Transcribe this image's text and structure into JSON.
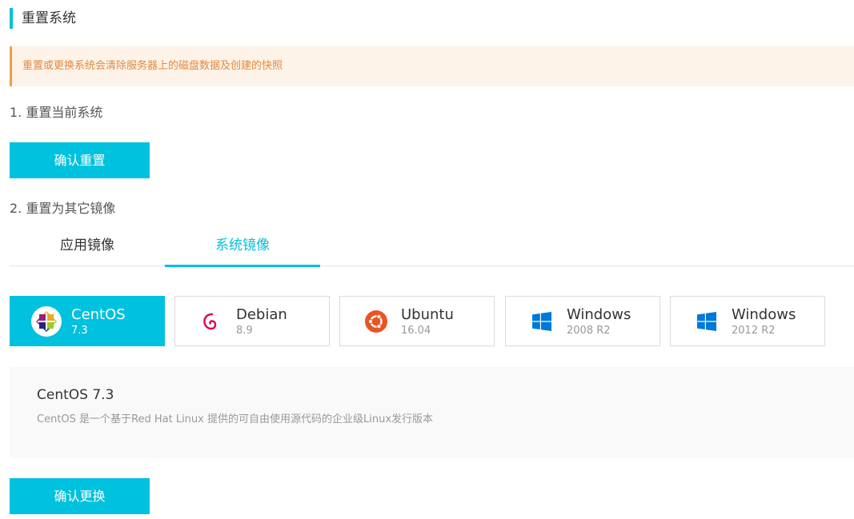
{
  "header": {
    "title": "重置系统"
  },
  "warning": {
    "text": "重置或更换系统会清除服务器上的磁盘数据及创建的快照"
  },
  "section1": {
    "title": "1. 重置当前系统",
    "button_label": "确认重置"
  },
  "section2": {
    "title": "2. 重置为其它镜像",
    "tabs": [
      {
        "label": "应用镜像",
        "active": false
      },
      {
        "label": "系统镜像",
        "active": true
      }
    ],
    "os_options": [
      {
        "name": "CentOS",
        "version": "7.3",
        "icon": "centos-icon",
        "selected": true
      },
      {
        "name": "Debian",
        "version": "8.9",
        "icon": "debian-icon",
        "selected": false
      },
      {
        "name": "Ubuntu",
        "version": "16.04",
        "icon": "ubuntu-icon",
        "selected": false
      },
      {
        "name": "Windows",
        "version": "2008 R2",
        "icon": "windows-icon",
        "selected": false
      },
      {
        "name": "Windows",
        "version": "2012 R2",
        "icon": "windows-icon",
        "selected": false
      }
    ],
    "description": {
      "title": "CentOS 7.3",
      "text": "CentOS 是一个基于Red Hat Linux 提供的可自由使用源代码的企业级Linux发行版本"
    },
    "button_label": "确认更换"
  },
  "colors": {
    "accent": "#00c1de",
    "warning_bg": "#fdf3e8",
    "warning_text": "#e6883e",
    "debian": "#d70751",
    "ubuntu": "#e95420",
    "windows": "#0078d7"
  }
}
